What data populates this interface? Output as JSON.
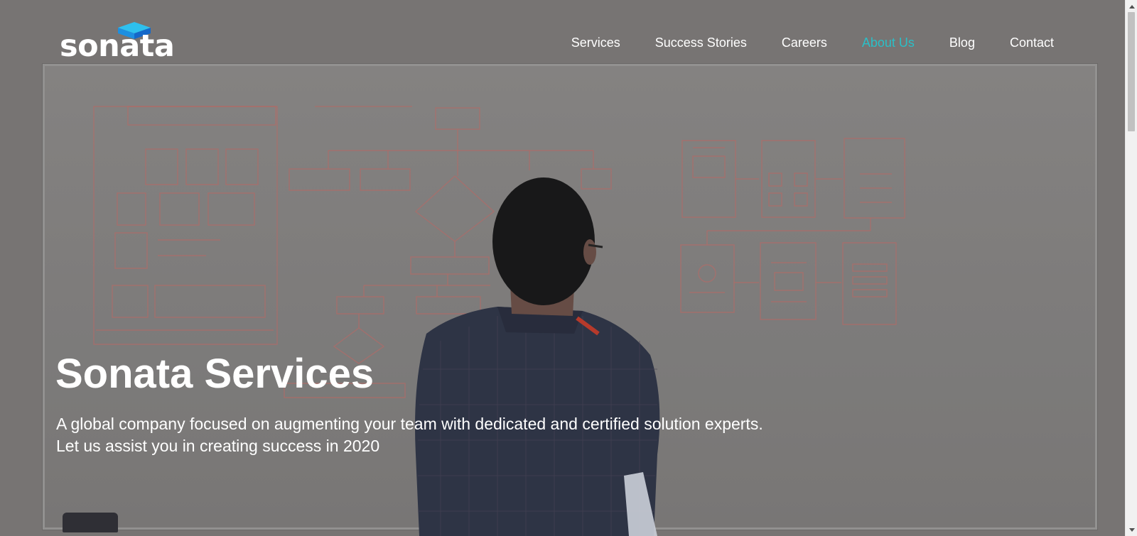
{
  "brand": {
    "name": "sonata",
    "logo_mark_colors": [
      "#1fb0e8",
      "#1674d6"
    ]
  },
  "nav": {
    "items": [
      {
        "label": "Services",
        "active": false
      },
      {
        "label": "Success Stories",
        "active": false
      },
      {
        "label": "Careers",
        "active": false
      },
      {
        "label": "About Us",
        "active": true
      },
      {
        "label": "Blog",
        "active": false
      },
      {
        "label": "Contact",
        "active": false
      }
    ],
    "active_color": "#2bbfc7"
  },
  "hero": {
    "title": "Sonata Services",
    "subtitle_line1": "A global company focused on augmenting your team with dedicated and certified solution experts.",
    "subtitle_line2": "Let us assist you in creating success in 2020",
    "background_image": "person-at-whiteboard"
  },
  "scrollbar": {
    "up_icon": "scroll-up-arrow-icon",
    "down_icon": "scroll-down-arrow-icon"
  }
}
